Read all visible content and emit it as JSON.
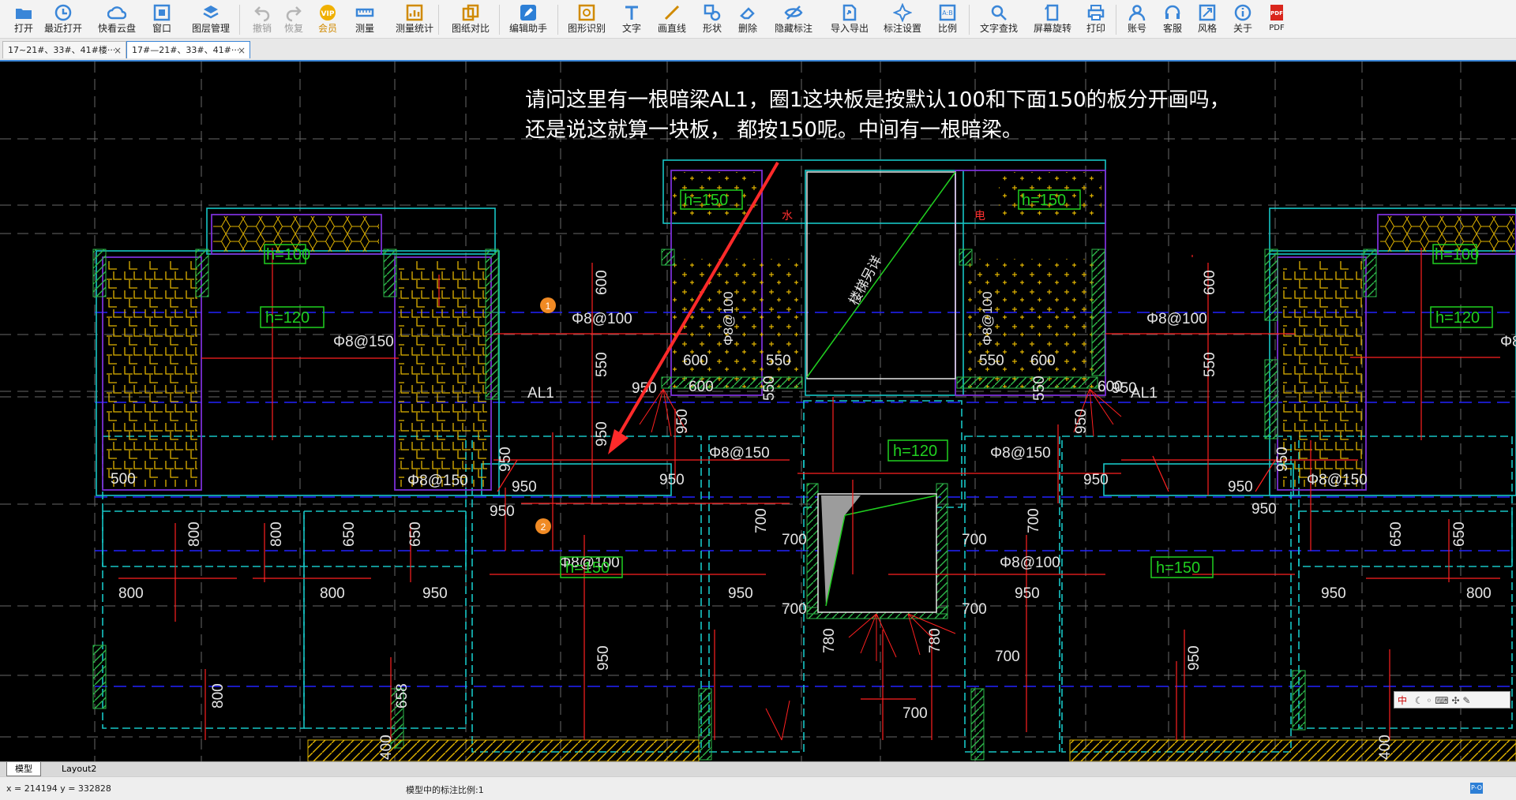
{
  "toolbar": {
    "items": [
      {
        "label": "打开",
        "icon": "folder-open-icon"
      },
      {
        "label": "最近打开",
        "icon": "recent-icon"
      },
      {
        "label": "快看云盘",
        "icon": "cloud-icon"
      },
      {
        "label": "窗口",
        "icon": "window-icon"
      },
      {
        "label": "图层管理",
        "icon": "layers-icon"
      },
      {
        "label": "撤销",
        "icon": "undo-icon"
      },
      {
        "label": "恢复",
        "icon": "redo-icon"
      },
      {
        "label": "会员",
        "icon": "vip-icon"
      },
      {
        "label": "测量",
        "icon": "measure-icon"
      },
      {
        "label": "测量统计",
        "icon": "measure-stats-icon"
      },
      {
        "label": "图纸对比",
        "icon": "compare-icon"
      },
      {
        "label": "编辑助手",
        "icon": "edit-assistant-icon"
      },
      {
        "label": "图形识别",
        "icon": "shape-recognition-icon"
      },
      {
        "label": "文字",
        "icon": "text-icon"
      },
      {
        "label": "画直线",
        "icon": "line-icon"
      },
      {
        "label": "形状",
        "icon": "shape-icon"
      },
      {
        "label": "删除",
        "icon": "eraser-icon"
      },
      {
        "label": "隐藏标注",
        "icon": "hide-annotation-icon"
      },
      {
        "label": "导入导出",
        "icon": "import-export-icon"
      },
      {
        "label": "标注设置",
        "icon": "annotation-settings-icon"
      },
      {
        "label": "比例",
        "icon": "scale-icon"
      },
      {
        "label": "文字查找",
        "icon": "text-search-icon"
      },
      {
        "label": "屏幕旋转",
        "icon": "rotate-screen-icon"
      },
      {
        "label": "打印",
        "icon": "print-icon"
      },
      {
        "label": "账号",
        "icon": "account-icon"
      },
      {
        "label": "客服",
        "icon": "support-icon"
      },
      {
        "label": "风格",
        "icon": "style-icon"
      },
      {
        "label": "关于",
        "icon": "about-icon"
      },
      {
        "label": "PDF",
        "icon": "pdf-icon"
      }
    ]
  },
  "tabs": [
    {
      "label": "17~21#、33#、41#楼···",
      "active": false
    },
    {
      "label": "17#—21#、33#、41#···",
      "active": true
    }
  ],
  "canvas": {
    "question_line1": "请问这里有一根暗梁AL1，圈1这块板是按默认100和下面150的板分开画吗，",
    "question_line2": "还是说这就算一块板， 都按150呢。中间有一根暗梁。",
    "labels": {
      "h150a": "h=150",
      "h150b": "h=150",
      "h100": "h=100",
      "h120a": "h=120",
      "h120b": "h=120",
      "h120c": "h=120",
      "h150c": "h=150",
      "h150d": "h=150",
      "h100b": "h=100",
      "al1a": "AL1",
      "al1b": "AL1",
      "p8100a": "Φ8@100",
      "p8150a": "Φ8@150",
      "p8100b": "Φ8@100",
      "p8150b": "Φ8@150",
      "p8150c": "Φ8@150",
      "p8150d": "Φ8@150",
      "p8150e": "Φ8@150",
      "p8100c": "Φ8@100",
      "p8100d": "Φ8@100",
      "p8150f": "Φ8@150",
      "d600a": "600",
      "d550a": "550",
      "d950a": "950",
      "d950b": "950",
      "d950c": "950",
      "d950d": "950",
      "d950e": "950",
      "d950f": "950",
      "d950g": "950",
      "d950h": "950",
      "d950i": "950",
      "d950j": "950",
      "d950k": "950",
      "d950l": "950",
      "d950m": "950",
      "d500": "500",
      "d800a": "800",
      "d800b": "800",
      "d800c": "800",
      "d800d": "800",
      "d800e": "800",
      "d650a": "650",
      "d650b": "650",
      "d650c": "650",
      "d650d": "650",
      "d658": "658",
      "d700a": "700",
      "d700b": "700",
      "d700c": "700",
      "d700d": "700",
      "d700e": "700",
      "d700f": "700",
      "d780a": "780",
      "d780b": "780",
      "d700g": "700",
      "d700h": "700",
      "d600b": "600",
      "d550b": "550",
      "d600c": "600",
      "d550c": "550",
      "d550d": "550",
      "d600d": "600",
      "d950n": "950",
      "d950o": "950",
      "d400a": "400",
      "d400b": "400",
      "stair": "楼梯另详",
      "m1": "1",
      "m2": "2",
      "shui": "水",
      "dian": "电"
    },
    "ime_text": "中"
  },
  "layout_tabs": [
    {
      "label": "模型",
      "active": true
    },
    {
      "label": "Layout2",
      "active": false
    }
  ],
  "status": {
    "coord": "x = 214194  y = 332828",
    "scale": "模型中的标注比例:1",
    "icon_text": "P-O"
  },
  "colors": {
    "wall_cyan": "#17c5c5",
    "slab_red": "#ff2020",
    "dim_white": "#e6e6e6",
    "label_green": "#20d020",
    "hatch_yellow": "#e0b300",
    "arrow_red": "#ff2a2a",
    "purple": "#7b2fd6",
    "marker_orange": "#f08a24"
  }
}
